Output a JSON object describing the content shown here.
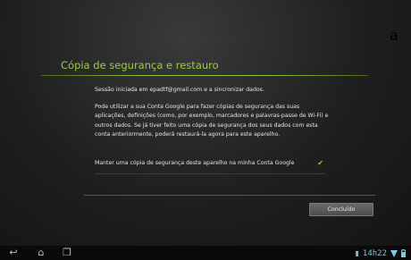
{
  "dialog": {
    "title": "Cópia de segurança e restauro",
    "paragraph1": "Sessão iniciada em epadtf@gmail.com e a sincronizar dados.",
    "paragraph2": "Pode utilizar a sua Conta Google para fazer cópias de segurança das suas aplicações, definições (como, por exemplo, marcadores e palavras-passe de Wi-Fi) e outros dados. Se já tiver feito uma cópia de segurança dos seus dados com esta conta anteriormente, poderá restaurá-la agora para este aparelho.",
    "backup_option": {
      "label": "Manter uma cópia de segurança deste aparelho na minha Conta Google",
      "checked": true,
      "check_glyph": "✔"
    },
    "done_button": "Concluído"
  },
  "edge_glyph": "a",
  "navbar": {
    "back_icon": "↩",
    "home_icon": "⌂",
    "recent_icon": "❐",
    "time": "14h22"
  },
  "colors": {
    "accent": "#9bcf3a",
    "background": "#1f1f1f"
  }
}
